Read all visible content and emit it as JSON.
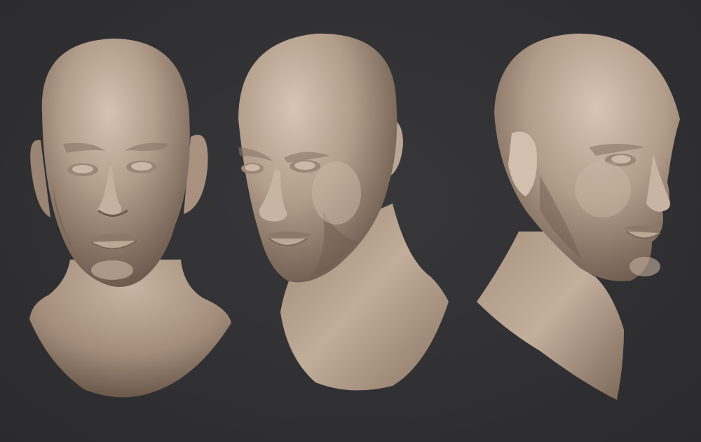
{
  "scene": {
    "background_color": "#313134",
    "material_color": "#b09a88",
    "material_shadow": "#6f5d50",
    "material_highlight": "#d9c7b6",
    "views": [
      {
        "id": "front",
        "description_icon": "bust-front-view"
      },
      {
        "id": "three-quarter",
        "description_icon": "bust-three-quarter-view"
      },
      {
        "id": "side",
        "description_icon": "bust-side-view"
      }
    ]
  }
}
